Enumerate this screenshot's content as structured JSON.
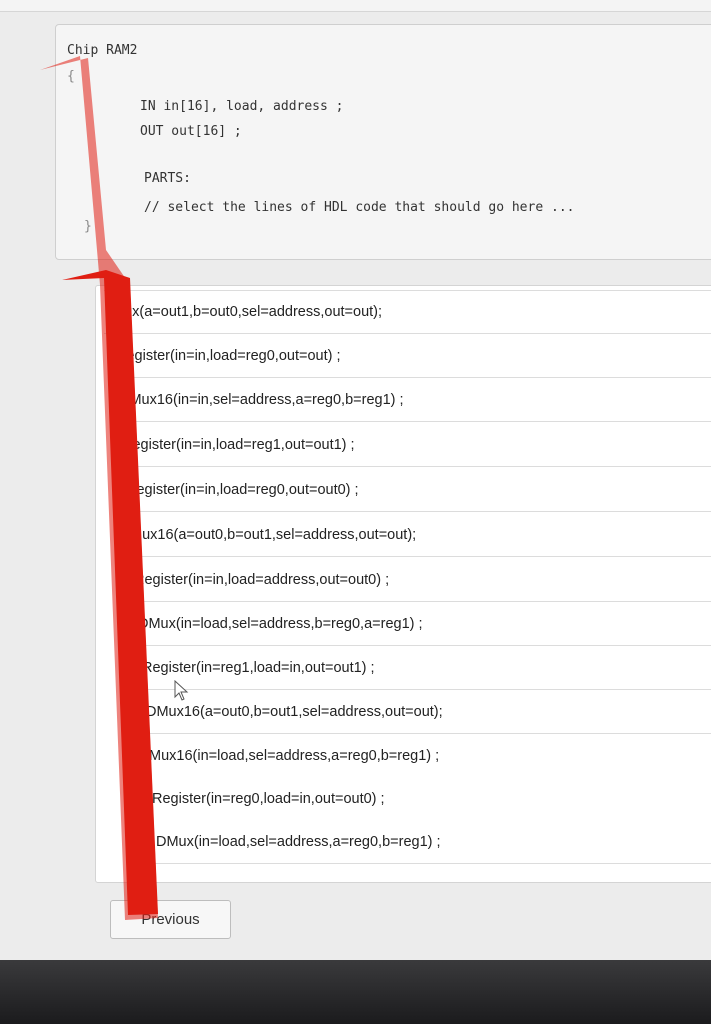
{
  "code": {
    "chip_line": "Chip RAM2",
    "open_brace": "{",
    "in_line": "IN in[16], load, address ;",
    "out_line": "OUT out[16] ;",
    "parts_label": "PARTS:",
    "comment_line": "// select the lines of HDL code that should go here ...",
    "close_brace": "}"
  },
  "answers": [
    "Mux(a=out1,b=out0,sel=address,out=out);",
    "Register(in=in,load=reg0,out=out) ;",
    "DMux16(in=in,sel=address,a=reg0,b=reg1) ;",
    "Register(in=in,load=reg1,out=out1) ;",
    "Register(in=in,load=reg0,out=out0) ;",
    "Mux16(a=out0,b=out1,sel=address,out=out);",
    "Register(in=in,load=address,out=out0) ;",
    "DMux(in=load,sel=address,b=reg0,a=reg1) ;",
    "Register(in=reg1,load=in,out=out1) ;",
    "DMux16(a=out0,b=out1,sel=address,out=out);",
    "Mux16(in=load,sel=address,a=reg0,b=reg1) ;",
    "Register(in=reg0,load=in,out=out0) ;",
    "DMux(in=load,sel=address,a=reg0,b=reg1) ;"
  ],
  "nav": {
    "previous_label": "Previous"
  },
  "colors": {
    "red_mark": "#e01e12"
  },
  "icons": {
    "cursor": "mouse-pointer-icon"
  }
}
